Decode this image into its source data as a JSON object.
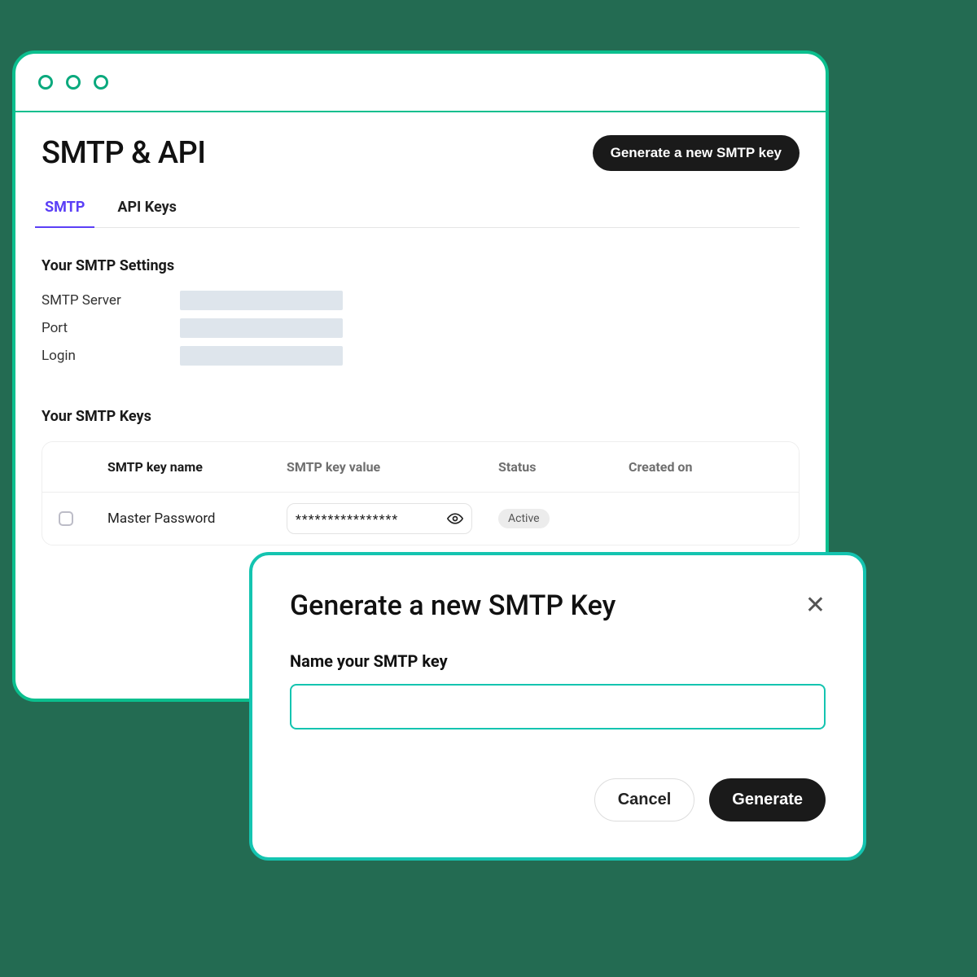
{
  "header": {
    "title": "SMTP & API",
    "generate_button": "Generate a new SMTP key"
  },
  "tabs": {
    "smtp": "SMTP",
    "api_keys": "API Keys"
  },
  "settings": {
    "title": "Your SMTP Settings",
    "rows": {
      "server_label": "SMTP Server",
      "port_label": "Port",
      "login_label": "Login"
    }
  },
  "keys": {
    "title": "Your SMTP Keys",
    "columns": {
      "name": "SMTP key name",
      "value": "SMTP key value",
      "status": "Status",
      "created": "Created on"
    },
    "rows": [
      {
        "name": "Master Password",
        "value": "****************",
        "status": "Active",
        "created": ""
      }
    ]
  },
  "modal": {
    "title": "Generate a new SMTP Key",
    "field_label": "Name your SMTP key",
    "input_value": "",
    "cancel": "Cancel",
    "generate": "Generate"
  }
}
